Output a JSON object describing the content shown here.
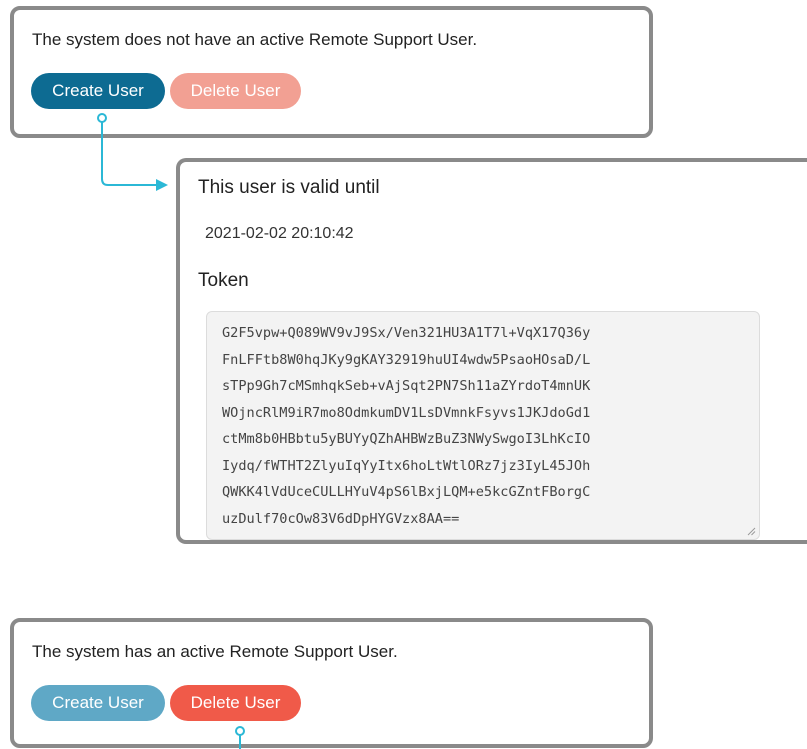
{
  "top_panel": {
    "status": "The system does not have an active Remote Support User.",
    "create_label": "Create User",
    "delete_label": "Delete User"
  },
  "user_panel": {
    "valid_heading": "This user is valid until",
    "valid_date": "2021-02-02 20:10:42",
    "token_heading": "Token",
    "token_lines": [
      "G2F5vpw+Q089WV9vJ9Sx/Ven321HU3A1T7l+VqX17Q36y",
      "FnLFFtb8W0hqJKy9gKAY32919huUI4wdw5PsaoHOsaD/L",
      "sTPp9Gh7cMSmhqkSeb+vAjSqt2PN7Sh11aZYrdoT4mnUK",
      "WOjncRlM9iR7mo8OdmkumDV1LsDVmnkFsyvs1JKJdoGd1",
      "ctMm8b0HBbtu5yBUYyQZhAHBWzBuZ3NWySwgoI3LhKcIO",
      "Iydq/fWTHT2ZlyuIqYyItx6hoLtWtlORz7jz3IyL45JOh",
      "QWKK4lVdUceCULLHYuV4pS6lBxjLQM+e5kcGZntFBorgC",
      "uzDulf70cOw83V6dDpHYGVzx8AA=="
    ]
  },
  "bottom_panel": {
    "status": "The system has an active Remote Support User.",
    "create_label": "Create User",
    "delete_label": "Delete User"
  },
  "colors": {
    "create_active": "#0d6b92",
    "create_inactive": "#5fa8c6",
    "delete_inactive": "#f2a093",
    "delete_active": "#f05a49",
    "connector": "#2bb8d6",
    "panel_border": "#8a8a8a"
  },
  "icons": {
    "connector": "arrow-connector-icon",
    "resize": "resize-grip-icon"
  }
}
